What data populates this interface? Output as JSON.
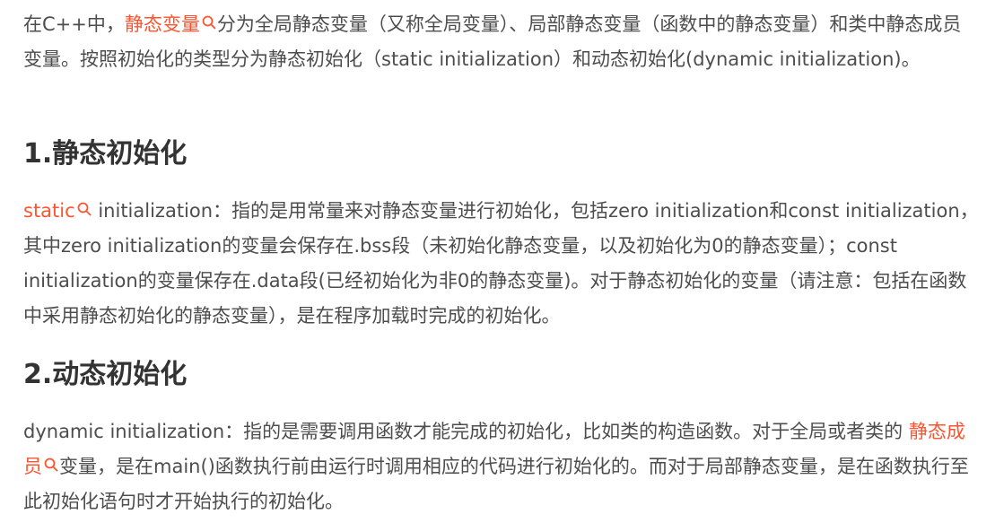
{
  "paragraph1": {
    "before": "在C++中，",
    "link": "静态变量",
    "after": "分为全局静态变量（又称全局变量）、局部静态变量（函数中的静态变量）和类中静态成员变量。按照初始化的类型分为静态初始化（static initialization）和动态初始化(dynamic initialization)。"
  },
  "heading1": "1.静态初始化",
  "paragraph2": {
    "link": "static",
    "after": " initialization：指的是用常量来对静态变量进行初始化，包括zero initialization和const initialization，其中zero initialization的变量会保存在.bss段（未初始化静态变量，以及初始化为0的静态变量）；const initialization的变量保存在.data段(已经初始化为非0的静态变量)。对于静态初始化的变量（请注意：包括在函数中采用静态初始化的静态变量），是在程序加载时完成的初始化。"
  },
  "heading2": "2.动态初始化",
  "paragraph3": {
    "before": "dynamic initialization：指的是需要调用函数才能完成的初始化，比如类的构造函数。对于全局或者类的 ",
    "link": "静态成员",
    "after": "变量，是在main()函数执行前由运行时调用相应的代码进行初始化的。而对于局部静态变量，是在函数执行至此初始化语句时才开始执行的初始化。"
  },
  "colors": {
    "link": "#fc5531",
    "text": "#4d4d4d",
    "heading": "#333333"
  },
  "icons": {
    "keyword_search": "search-icon"
  }
}
